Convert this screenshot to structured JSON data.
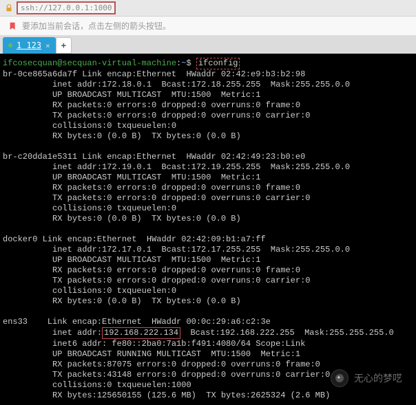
{
  "address_bar": {
    "url": "ssh://127.0.0.1:1000"
  },
  "hint": {
    "text": "要添加当前会话，点击左侧的箭头按钮。"
  },
  "tabs": {
    "active_label": "1 123",
    "new_label": "+"
  },
  "prompt": {
    "user_host": "ifcosecquan@secquan-virtual-machine",
    "path": "~",
    "symbol": "$",
    "command": "ifconfig"
  },
  "interfaces": [
    {
      "name": "br-0ce865a6da7f",
      "lines": [
        "Link encap:Ethernet  HWaddr 02:42:e9:b3:b2:98",
        "inet addr:172.18.0.1  Bcast:172.18.255.255  Mask:255.255.0.0",
        "UP BROADCAST MULTICAST  MTU:1500  Metric:1",
        "RX packets:0 errors:0 dropped:0 overruns:0 frame:0",
        "TX packets:0 errors:0 dropped:0 overruns:0 carrier:0",
        "collisions:0 txqueuelen:0",
        "RX bytes:0 (0.0 B)  TX bytes:0 (0.0 B)"
      ]
    },
    {
      "name": "br-c20dda1e5311",
      "lines": [
        "Link encap:Ethernet  HWaddr 02:42:49:23:b0:e0",
        "inet addr:172.19.0.1  Bcast:172.19.255.255  Mask:255.255.0.0",
        "UP BROADCAST MULTICAST  MTU:1500  Metric:1",
        "RX packets:0 errors:0 dropped:0 overruns:0 frame:0",
        "TX packets:0 errors:0 dropped:0 overruns:0 carrier:0",
        "collisions:0 txqueuelen:0",
        "RX bytes:0 (0.0 B)  TX bytes:0 (0.0 B)"
      ]
    },
    {
      "name": "docker0",
      "lines": [
        "Link encap:Ethernet  HWaddr 02:42:09:b1:a7:ff",
        "inet addr:172.17.0.1  Bcast:172.17.255.255  Mask:255.255.0.0",
        "UP BROADCAST MULTICAST  MTU:1500  Metric:1",
        "RX packets:0 errors:0 dropped:0 overruns:0 frame:0",
        "TX packets:0 errors:0 dropped:0 overruns:0 carrier:0",
        "collisions:0 txqueuelen:0",
        "RX bytes:0 (0.0 B)  TX bytes:0 (0.0 B)"
      ]
    },
    {
      "name": "ens33",
      "highlight_ip": "192.168.222.134",
      "pre_ip": "inet addr:",
      "post_ip": "  Bcast:192.168.222.255  Mask:255.255.255.0",
      "lines_before": [
        "Link encap:Ethernet  HWaddr 00:0c:29:a6:c2:3e"
      ],
      "lines_after": [
        "inet6 addr: fe80::2ba0:7a1b:f491:4080/64 Scope:Link",
        "UP BROADCAST RUNNING MULTICAST  MTU:1500  Metric:1",
        "RX packets:87075 errors:0 dropped:0 overruns:0 frame:0",
        "TX packets:43148 errors:0 dropped:0 overruns:0 carrier:0",
        "collisions:0 txqueuelen:1000",
        "RX bytes:125650155 (125.6 MB)  TX bytes:2625324 (2.6 MB)"
      ]
    }
  ],
  "watermark": {
    "text": "无心的梦呓"
  }
}
